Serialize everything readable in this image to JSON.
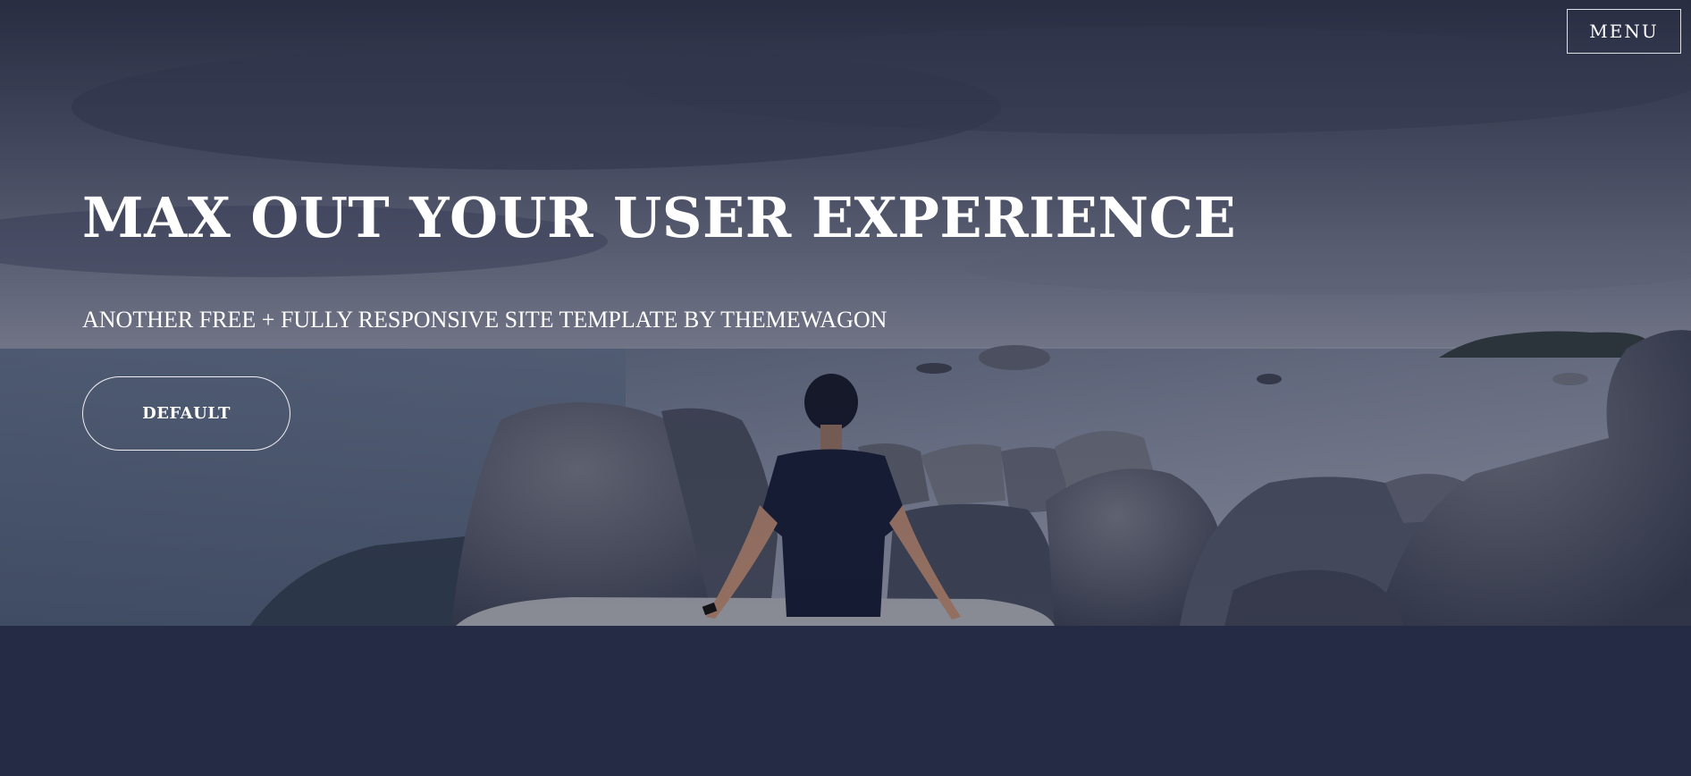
{
  "nav": {
    "menu_label": "MENU"
  },
  "hero": {
    "title": "MAX OUT YOUR USER EXPERIENCE",
    "subtitle": "ANOTHER FREE + FULLY RESPONSIVE SITE TEMPLATE BY THEMEWAGON",
    "button_label": "DEFAULT",
    "image_alt": "Person sitting on rocks by the sea"
  },
  "colors": {
    "page_background": "#262b45",
    "text": "#ffffff",
    "overlay": "#2c3150"
  }
}
